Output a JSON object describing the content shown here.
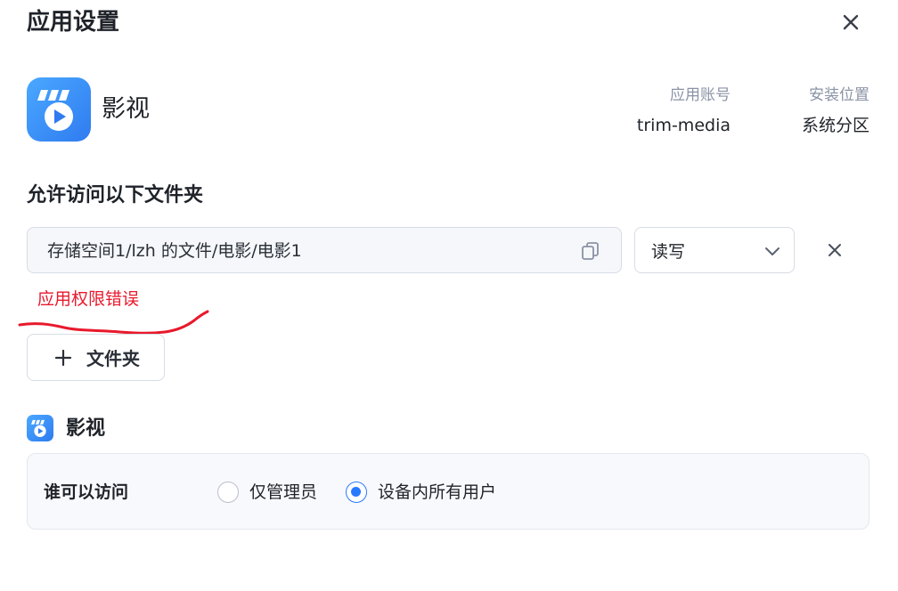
{
  "dialog": {
    "title": "应用设置"
  },
  "app": {
    "name": "影视",
    "account_label": "应用账号",
    "account_value": "trim-media",
    "location_label": "安装位置",
    "location_value": "系统分区",
    "icon": "film-clapper-play-icon",
    "icon_color": "#2f7bf0"
  },
  "folders": {
    "section_title": "允许访问以下文件夹",
    "items": [
      {
        "path": "存储空间1/lzh 的文件/电影/电影1",
        "permission": "读写",
        "error": "应用权限错误"
      }
    ],
    "add_button_label": "文件夹"
  },
  "access": {
    "app_name": "影视",
    "label": "谁可以访问",
    "options": [
      {
        "label": "仅管理员",
        "selected": false
      },
      {
        "label": "设备内所有用户",
        "selected": true
      }
    ],
    "accent_color": "#2979ff"
  },
  "colors": {
    "error": "#e8192c",
    "annotation_stroke": "#e8192c"
  }
}
